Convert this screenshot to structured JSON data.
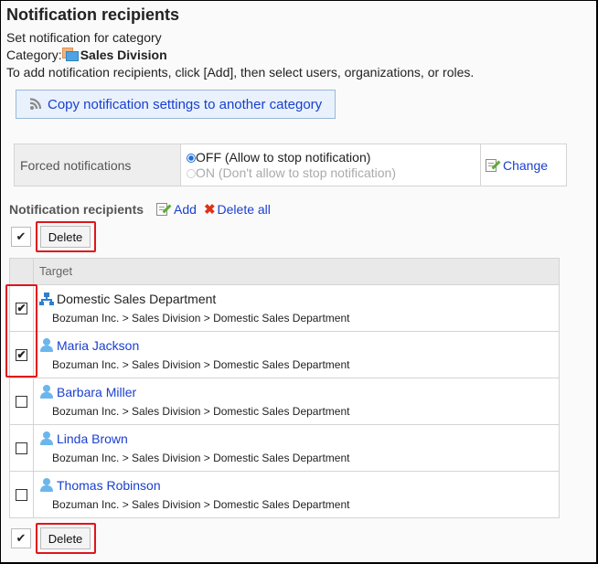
{
  "page": {
    "title": "Notification recipients",
    "subtitle": "Set notification for category",
    "category_label": "Category:",
    "category_name": "Sales Division",
    "instructions": "To add notification recipients, click [Add], then select users, organizations, or roles."
  },
  "copy_button": {
    "icon": "rss-icon",
    "label": "Copy notification settings to another category"
  },
  "forced_notifications": {
    "label": "Forced notifications",
    "options": [
      {
        "label": "OFF (Allow to stop notification)",
        "selected": true,
        "enabled": true
      },
      {
        "label": "ON (Don't allow to stop notification)",
        "selected": false,
        "enabled": false
      }
    ],
    "change_label": "Change"
  },
  "recipients": {
    "heading": "Notification recipients",
    "add_label": "Add",
    "delete_all_label": "Delete all",
    "toggle_all_symbol": "✔",
    "delete_label": "Delete",
    "column_target": "Target",
    "rows": [
      {
        "type": "organization",
        "name": "Domestic Sales Department",
        "path": "Bozuman Inc. > Sales Division > Domestic Sales Department",
        "checked": true
      },
      {
        "type": "user",
        "name": "Maria Jackson",
        "path": "Bozuman Inc. > Sales Division > Domestic Sales Department",
        "checked": true
      },
      {
        "type": "user",
        "name": "Barbara Miller",
        "path": "Bozuman Inc. > Sales Division > Domestic Sales Department",
        "checked": false
      },
      {
        "type": "user",
        "name": "Linda Brown",
        "path": "Bozuman Inc. > Sales Division > Domestic Sales Department",
        "checked": false
      },
      {
        "type": "user",
        "name": "Thomas Robinson",
        "path": "Bozuman Inc. > Sales Division > Domestic Sales Department",
        "checked": false
      }
    ]
  },
  "highlight_color": "#e0151b",
  "link_color": "#1a3fcf"
}
